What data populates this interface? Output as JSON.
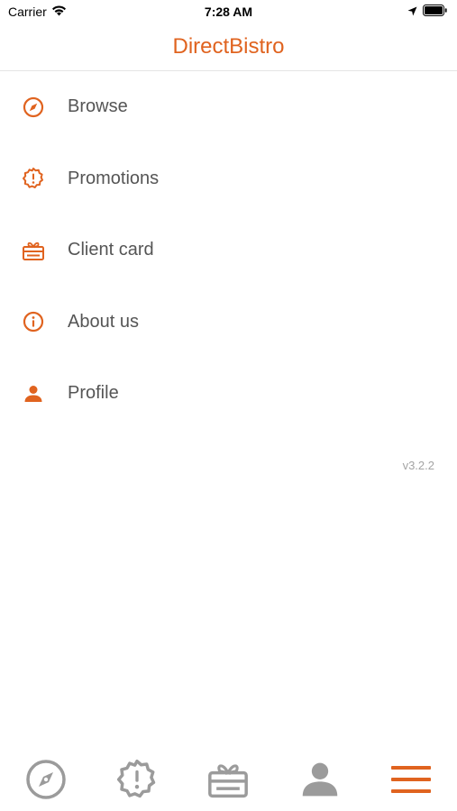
{
  "status_bar": {
    "carrier": "Carrier",
    "time": "7:28 AM"
  },
  "header": {
    "title": "DirectBistro"
  },
  "menu": {
    "items": [
      {
        "label": "Browse",
        "icon": "compass-icon"
      },
      {
        "label": "Promotions",
        "icon": "promotion-badge-icon"
      },
      {
        "label": "Client card",
        "icon": "gift-card-icon"
      },
      {
        "label": "About us",
        "icon": "info-icon"
      },
      {
        "label": "Profile",
        "icon": "person-icon"
      }
    ]
  },
  "version": "v3.2.2",
  "tab_bar": {
    "tabs": [
      {
        "icon": "compass-icon",
        "active": false
      },
      {
        "icon": "promotion-badge-icon",
        "active": false
      },
      {
        "icon": "gift-card-icon",
        "active": false
      },
      {
        "icon": "person-icon",
        "active": false
      },
      {
        "icon": "menu-icon",
        "active": true
      }
    ]
  },
  "colors": {
    "accent": "#e0631f",
    "inactive": "#9b9b9b",
    "text": "#555555",
    "muted": "#a4a4a4"
  }
}
